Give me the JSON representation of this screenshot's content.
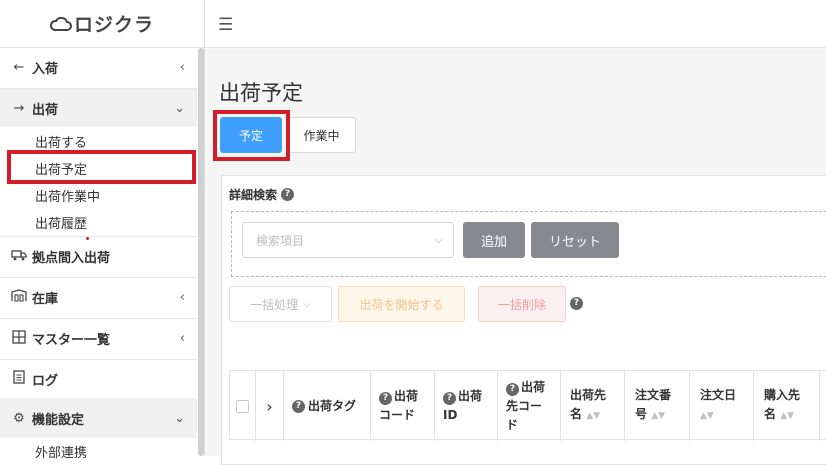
{
  "app": {
    "logo_text": "ロジクラ"
  },
  "sidebar": {
    "items": [
      {
        "icon": "arrow-left-icon",
        "glyph": "←",
        "label": "入荷",
        "chevron": "‹"
      },
      {
        "icon": "arrow-right-icon",
        "glyph": "→",
        "label": "出荷",
        "chevron": "⌄"
      },
      {
        "icon": "truck-icon",
        "glyph": "🚚",
        "label": "拠点間入出荷"
      },
      {
        "icon": "warehouse-icon",
        "glyph": "▦",
        "label": "在庫",
        "chevron": "‹"
      },
      {
        "icon": "grid-icon",
        "glyph": "⊞",
        "label": "マスター一覧",
        "chevron": "‹"
      },
      {
        "icon": "document-icon",
        "glyph": "▤",
        "label": "ログ"
      },
      {
        "icon": "gear-icon",
        "glyph": "⚙",
        "label": "機能設定",
        "chevron": "⌄"
      }
    ],
    "sub_items": [
      "出荷する",
      "出荷予定",
      "出荷作業中",
      "出荷履歴"
    ],
    "sub_items_bottom": [
      "外部連携"
    ]
  },
  "topbar": {
    "menu_icon": "☰"
  },
  "main": {
    "page_title": "出荷予定",
    "tabs": [
      "予定",
      "作業中"
    ],
    "search": {
      "title": "詳細検索",
      "placeholder": "検索項目",
      "add_label": "追加",
      "reset_label": "リセット"
    },
    "actions": {
      "bulk_label": "一括処理",
      "start_label": "出荷を開始する",
      "delete_label": "一括削除"
    },
    "table": {
      "columns": [
        {
          "label": "出荷タグ",
          "help": true
        },
        {
          "label": "出荷コード",
          "help": true
        },
        {
          "label": "出荷ID",
          "help": true
        },
        {
          "label": "出荷先コード",
          "help": true
        },
        {
          "label": "出荷先名",
          "sortable": true
        },
        {
          "label": "注文番号",
          "sortable": true
        },
        {
          "label": "注文日",
          "sortable": true
        },
        {
          "label": "購入先名",
          "sortable": true
        }
      ]
    }
  },
  "colors": {
    "accent": "#3f9ffa",
    "highlight": "#d11e2a",
    "button_gray": "#86898f"
  }
}
